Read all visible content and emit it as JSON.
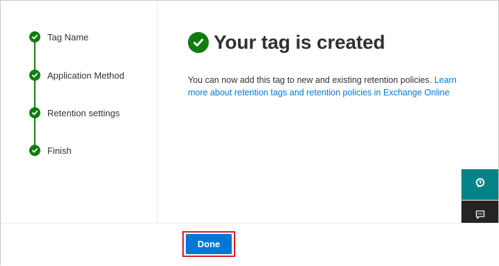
{
  "steps": [
    {
      "label": "Tag Name",
      "status": "complete"
    },
    {
      "label": "Application Method",
      "status": "complete"
    },
    {
      "label": "Retention settings",
      "status": "complete"
    },
    {
      "label": "Finish",
      "status": "complete"
    }
  ],
  "main": {
    "title": "Your tag is created",
    "description": "You can now add this tag to new and existing retention policies. ",
    "learn_more_link": "Learn more about retention tags and retention policies in Exchange Online"
  },
  "side_buttons": {
    "help_icon": "help-chat-icon",
    "feedback_icon": "feedback-icon"
  },
  "footer": {
    "done_label": "Done"
  },
  "colors": {
    "success": "#107c10",
    "accent": "#0078d4",
    "help_button": "#038387",
    "feedback_button": "#252423",
    "highlight": "#d71920"
  }
}
